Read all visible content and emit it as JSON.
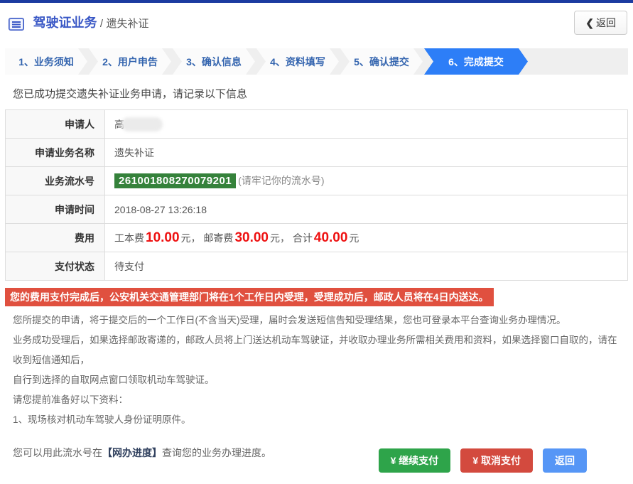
{
  "header": {
    "title": "驾驶证业务",
    "separator": "/",
    "subtitle": "遗失补证",
    "back_chevron": "❮",
    "back_label": "返回"
  },
  "steps": {
    "active_index": 5,
    "items": [
      {
        "label": "1、业务须知"
      },
      {
        "label": "2、用户申告"
      },
      {
        "label": "3、确认信息"
      },
      {
        "label": "4、资料填写"
      },
      {
        "label": "5、确认提交"
      },
      {
        "label": "6、完成提交"
      }
    ]
  },
  "result": {
    "success_message": "您已成功提交遗失补证业务申请，请记录以下信息",
    "rows": {
      "applicant": {
        "label": "申请人",
        "value": "高",
        "redacted": true
      },
      "service_name": {
        "label": "申请业务名称",
        "value": "遗失补证"
      },
      "serial": {
        "label": "业务流水号",
        "number": "261001808270079201",
        "note": "(请牢记你的流水号)"
      },
      "apply_time": {
        "label": "申请时间",
        "value": "2018-08-27 13:26:18"
      },
      "fee": {
        "label": "费用",
        "parts": [
          {
            "name": "工本费",
            "amount": "10.00",
            "suffix": "元，"
          },
          {
            "name": "邮寄费",
            "amount": "30.00",
            "suffix": "元，"
          },
          {
            "name": "合计",
            "amount": "40.00",
            "suffix": "元"
          }
        ]
      },
      "pay_status": {
        "label": "支付状态",
        "value": "待支付"
      }
    }
  },
  "notice": {
    "banner": "您的费用支付完成后，公安机关交通管理部门将在1个工作日内受理，受理成功后，邮政人员将在4日内送达。",
    "paragraphs": [
      "您所提交的申请，将于提交后的一个工作日(不含当天)受理，届时会发送短信告知受理结果，您也可登录本平台查询业务办理情况。",
      "业务成功受理后，如果选择邮政寄递的，邮政人员将上门送达机动车驾驶证，并收取办理业务所需相关费用和资料，如果选择窗口自取的，请在收到短信通知后，",
      "自行到选择的自取网点窗口领取机动车驾驶证。",
      "请您提前准备好以下资料：",
      "1、现场核对机动车驾驶人身份证明原件。"
    ],
    "progress_hint": {
      "prefix": "您可以用此流水号在",
      "highlight": "【网办进度】",
      "suffix": "查询您的业务办理进度。"
    }
  },
  "footer": {
    "continue_pay": "¥ 继续支付",
    "cancel_pay": "¥ 取消支付",
    "back": "返回"
  },
  "colors": {
    "top_bar_navy": "#1c3ba0",
    "title_blue": "#3a58c6",
    "active_step_blue": "#2d7ef7",
    "step_text_blue": "#3465af",
    "serial_badge_green": "#35823b",
    "fee_red": "#ee1111",
    "banner_red": "#e0503f",
    "button_green": "#2ea44a",
    "button_red": "#d34a3e",
    "button_blue": "#5696f6"
  }
}
